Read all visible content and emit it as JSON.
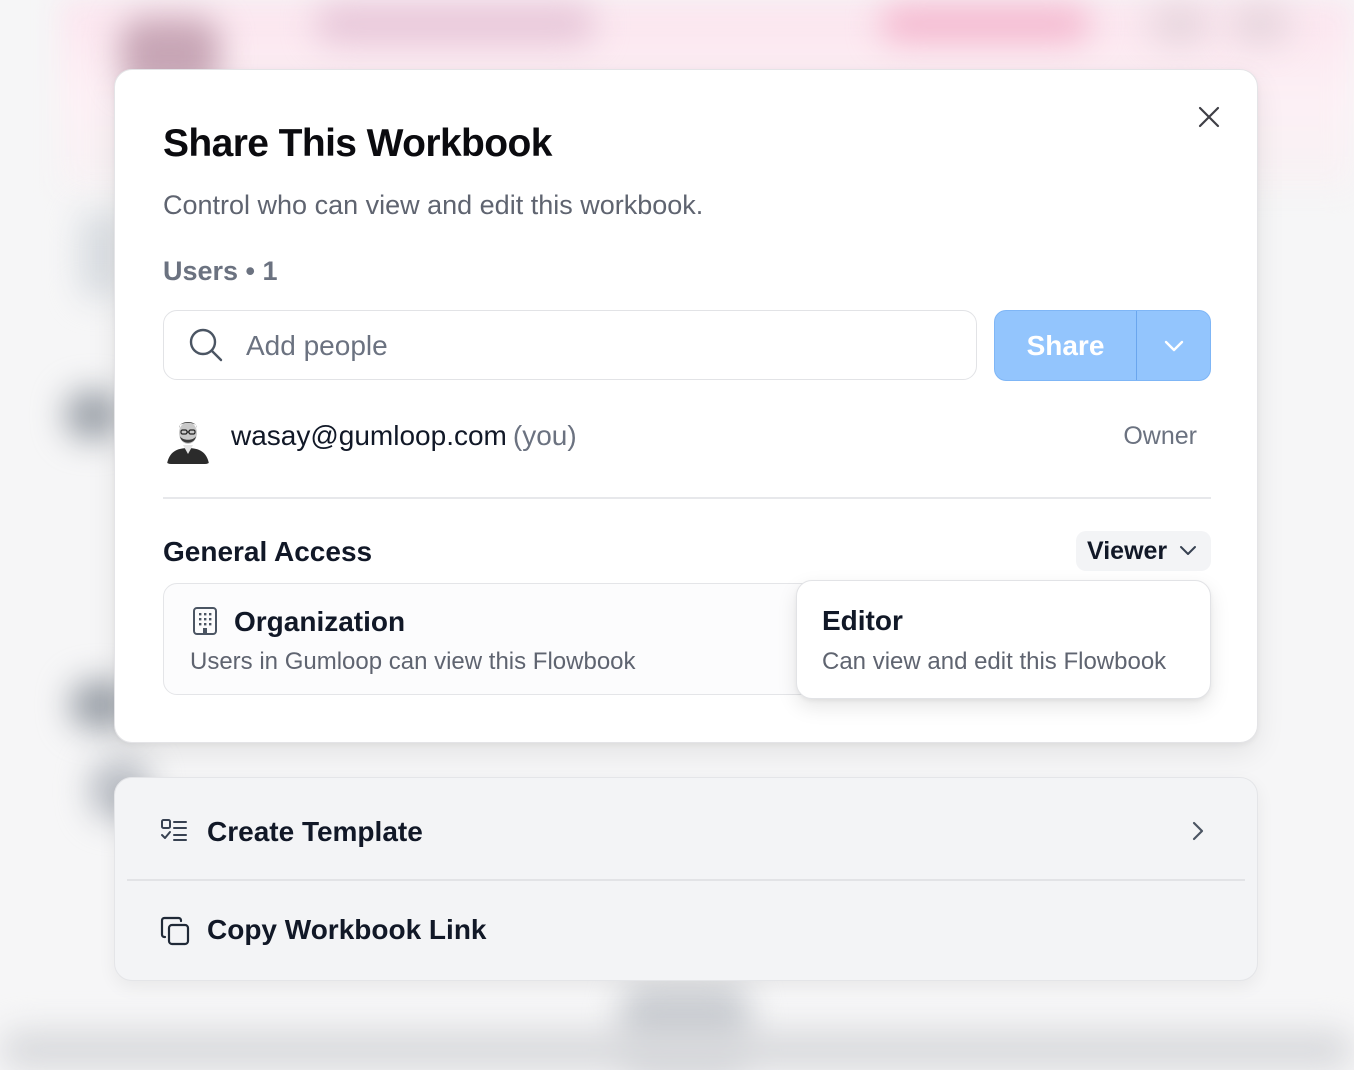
{
  "dialog": {
    "title": "Share This Workbook",
    "subtitle": "Control who can view and edit this workbook.",
    "users_count_label": "Users • 1",
    "close_icon": "close-icon"
  },
  "search": {
    "placeholder": "Add people",
    "value": "",
    "icon": "search-icon"
  },
  "share_button": {
    "label": "Share",
    "dropdown_icon": "chevron-down-icon",
    "color": "#93c5fd"
  },
  "users": [
    {
      "email": "wasay@gumloop.com",
      "you_tag": "(you)",
      "role": "Owner"
    }
  ],
  "general_access": {
    "label": "General Access",
    "selected_role": "Viewer",
    "scope": {
      "name": "Organization",
      "description": "Users in Gumloop can view this Flowbook",
      "icon": "building-icon"
    }
  },
  "role_popover": {
    "options": [
      {
        "title": "Editor",
        "description": "Can view and edit this Flowbook"
      }
    ]
  },
  "actions": [
    {
      "label": "Create Template",
      "icon": "template-checklist-icon",
      "has_chevron": true
    },
    {
      "label": "Copy Workbook Link",
      "icon": "copy-icon",
      "has_chevron": false
    }
  ]
}
